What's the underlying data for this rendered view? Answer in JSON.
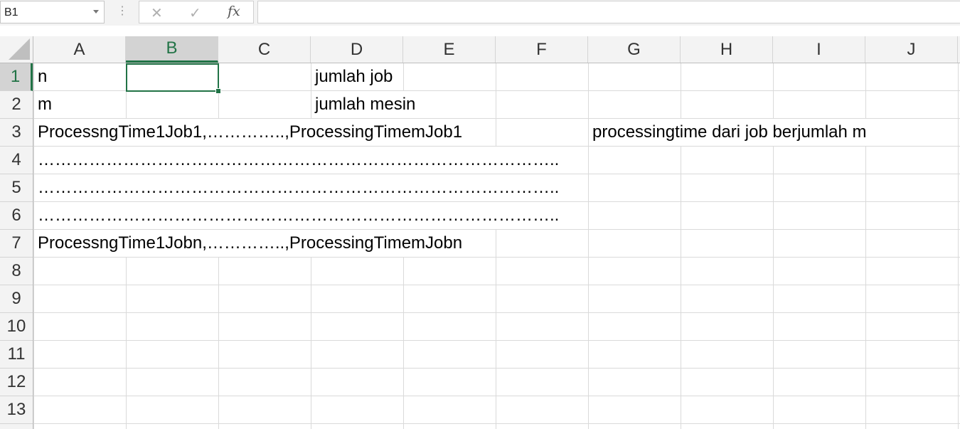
{
  "formula_bar": {
    "name_box": "B1",
    "cancel_icon": "✕",
    "enter_icon": "✓",
    "fx_label": "fx",
    "formula": ""
  },
  "columns": [
    "A",
    "B",
    "C",
    "D",
    "E",
    "F",
    "G",
    "H",
    "I",
    "J"
  ],
  "rows": [
    "1",
    "2",
    "3",
    "4",
    "5",
    "6",
    "7",
    "8",
    "9",
    "10",
    "11",
    "12",
    "13"
  ],
  "selection": {
    "cell": "B1",
    "column": "B",
    "row": "1"
  },
  "cells": {
    "A1": "n",
    "D1": "jumlah job",
    "A2": "m",
    "D2": "jumlah mesin",
    "A3": "ProcessngTime1Job1,…………..,ProcessingTimemJob1",
    "G3": "processingtime dari job berjumlah m",
    "A4": "………………………………………………………………………………..",
    "A5": "………………………………………………………………………………..",
    "A6": "………………………………………………………………………………..",
    "A7": "ProcessngTime1Jobn,…………..,ProcessingTimemJobn"
  },
  "colors": {
    "accent": "#217346",
    "gridline": "#dadada",
    "header_bg": "#f3f3f3"
  }
}
